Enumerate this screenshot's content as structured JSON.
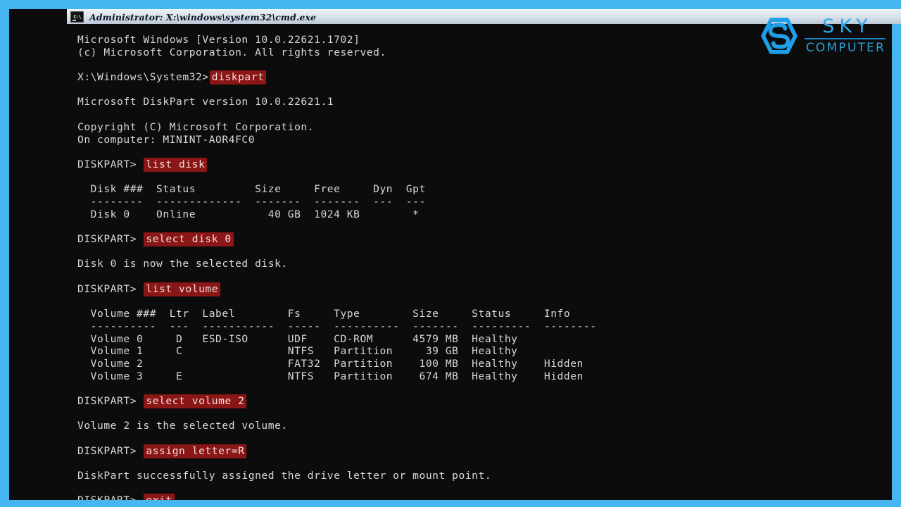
{
  "window": {
    "title": "Administrator: X:\\windows\\system32\\cmd.exe",
    "icon_name": "cmd-icon",
    "icon_glyph": "C:\\",
    "frame_color": "#45b6f0",
    "background_color": "#0c0c0c",
    "text_color": "#d8d8d8",
    "highlight_background": "#8b1616",
    "highlight_text_color": "#f2dede"
  },
  "logo": {
    "mark_name": "sky-hexagon-s-logo",
    "primary_text": "SKY",
    "secondary_text": "COMPUTER",
    "primary_color": "#2ba9ea",
    "secondary_color": "#27a3d8",
    "rule_color": "#1b7fc4"
  },
  "terminal": {
    "lines": [
      {
        "text": "Microsoft Windows [Version 10.0.22621.1702]"
      },
      {
        "text": "(c) Microsoft Corporation. All rights reserved."
      },
      {
        "text": ""
      },
      {
        "prompt": "X:\\Windows\\System32>",
        "command": "diskpart"
      },
      {
        "text": ""
      },
      {
        "text": "Microsoft DiskPart version 10.0.22621.1"
      },
      {
        "text": ""
      },
      {
        "text": "Copyright (C) Microsoft Corporation."
      },
      {
        "text": "On computer: MININT-AOR4FC0"
      },
      {
        "text": ""
      },
      {
        "prompt": "DISKPART> ",
        "command": "list disk"
      },
      {
        "text": ""
      },
      {
        "text": "  Disk ###  Status         Size     Free     Dyn  Gpt"
      },
      {
        "text": "  --------  -------------  -------  -------  ---  ---"
      },
      {
        "text": "  Disk 0    Online           40 GB  1024 KB        *"
      },
      {
        "text": ""
      },
      {
        "prompt": "DISKPART> ",
        "command": "select disk 0"
      },
      {
        "text": ""
      },
      {
        "text": "Disk 0 is now the selected disk."
      },
      {
        "text": ""
      },
      {
        "prompt": "DISKPART> ",
        "command": "list volume"
      },
      {
        "text": ""
      },
      {
        "text": "  Volume ###  Ltr  Label        Fs     Type        Size     Status     Info"
      },
      {
        "text": "  ----------  ---  -----------  -----  ----------  -------  ---------  --------"
      },
      {
        "text": "  Volume 0     D   ESD-ISO      UDF    CD-ROM      4579 MB  Healthy"
      },
      {
        "text": "  Volume 1     C                NTFS   Partition     39 GB  Healthy"
      },
      {
        "text": "  Volume 2                      FAT32  Partition    100 MB  Healthy    Hidden"
      },
      {
        "text": "  Volume 3     E                NTFS   Partition    674 MB  Healthy    Hidden"
      },
      {
        "text": ""
      },
      {
        "prompt": "DISKPART> ",
        "command": "select volume 2"
      },
      {
        "text": ""
      },
      {
        "text": "Volume 2 is the selected volume."
      },
      {
        "text": ""
      },
      {
        "prompt": "DISKPART> ",
        "command": "assign letter=R"
      },
      {
        "text": ""
      },
      {
        "text": "DiskPart successfully assigned the drive letter or mount point."
      },
      {
        "text": ""
      },
      {
        "prompt": "DISKPART> ",
        "command": "exit"
      }
    ]
  },
  "table_disk": {
    "headers": [
      "Disk ###",
      "Status",
      "Size",
      "Free",
      "Dyn",
      "Gpt"
    ],
    "rows": [
      [
        "Disk 0",
        "Online",
        "40 GB",
        "1024 KB",
        "",
        "*"
      ]
    ]
  },
  "table_volume": {
    "headers": [
      "Volume ###",
      "Ltr",
      "Label",
      "Fs",
      "Type",
      "Size",
      "Status",
      "Info"
    ],
    "rows": [
      [
        "Volume 0",
        "D",
        "ESD-ISO",
        "UDF",
        "CD-ROM",
        "4579 MB",
        "Healthy",
        ""
      ],
      [
        "Volume 1",
        "C",
        "",
        "NTFS",
        "Partition",
        "39 GB",
        "Healthy",
        ""
      ],
      [
        "Volume 2",
        "",
        "",
        "FAT32",
        "Partition",
        "100 MB",
        "Healthy",
        "Hidden"
      ],
      [
        "Volume 3",
        "E",
        "",
        "NTFS",
        "Partition",
        "674 MB",
        "Healthy",
        "Hidden"
      ]
    ]
  }
}
